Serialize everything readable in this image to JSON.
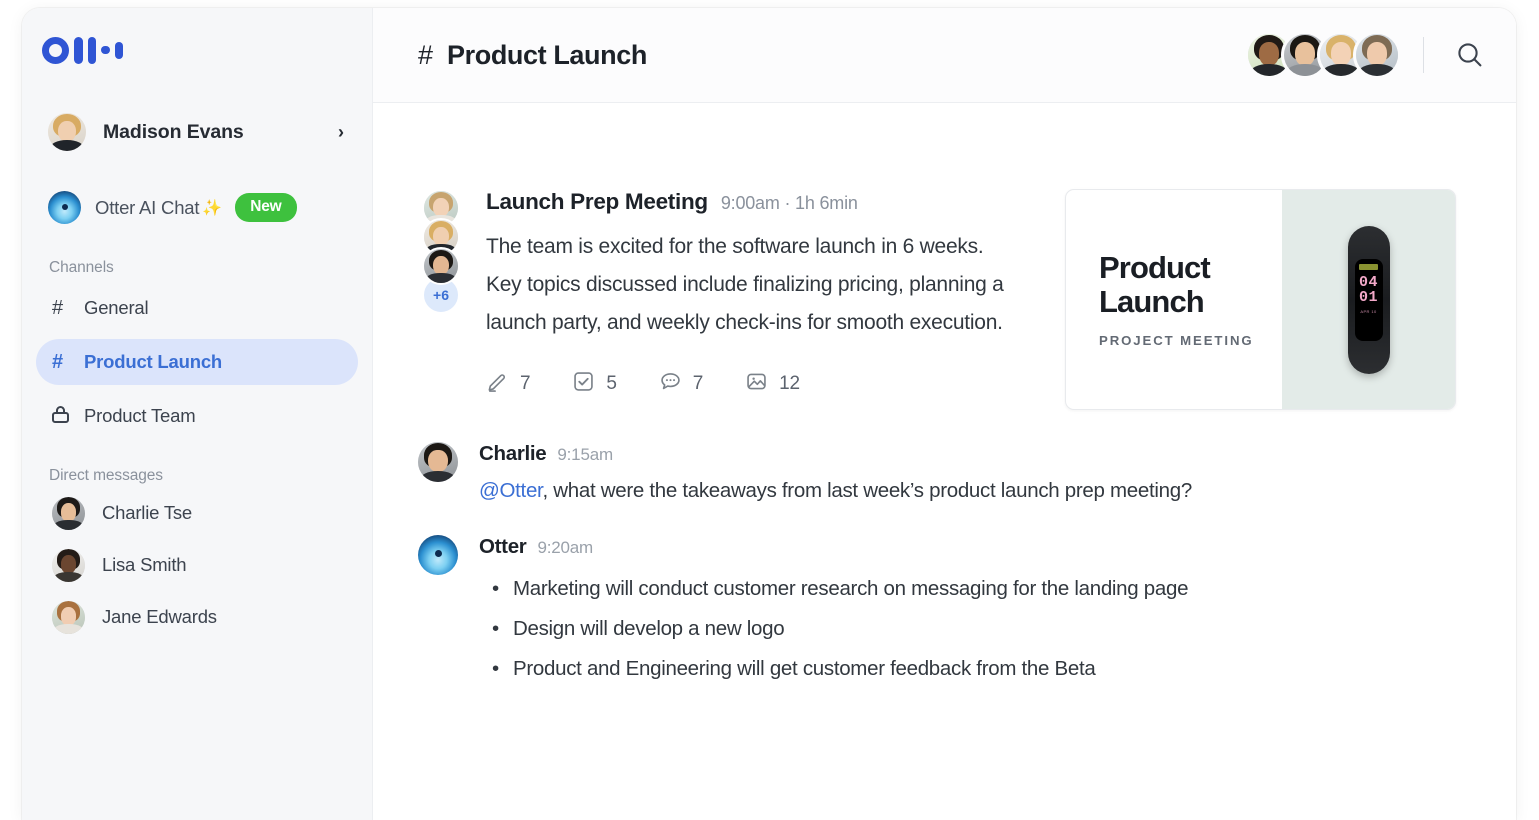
{
  "brand": {
    "logo_name": "otter-logo",
    "accent": "#2f55d4"
  },
  "sidebar": {
    "user": {
      "name": "Madison Evans",
      "chevron": "›"
    },
    "otter_chat": {
      "label": "Otter AI Chat",
      "sparkle": "✨",
      "badge": "New",
      "badge_color": "#3ec13e"
    },
    "channels_label": "Channels",
    "channels": [
      {
        "glyph": "#",
        "label": "General",
        "active": false,
        "icon": "hash-icon"
      },
      {
        "glyph": "#",
        "label": "Product Launch",
        "active": true,
        "icon": "hash-icon"
      },
      {
        "glyph": "lock",
        "label": "Product Team",
        "active": false,
        "icon": "lock-icon"
      }
    ],
    "dm_label": "Direct messages",
    "dms": [
      {
        "name": "Charlie Tse"
      },
      {
        "name": "Lisa Smith"
      },
      {
        "name": "Jane Edwards"
      }
    ]
  },
  "header": {
    "hash": "#",
    "title": "Product Launch",
    "member_count_shown": 4,
    "search_icon": "search-icon"
  },
  "meeting": {
    "title": "Launch Prep Meeting",
    "time": "9:00am",
    "separator": "·",
    "duration": "1h 6min",
    "meta": "9:00am · 1h 6min",
    "summary": "The team is excited for the software launch in 6 weeks. Key topics discussed include finalizing pricing, planning a launch party, and weekly check-ins for smooth execution.",
    "extra_participants": "+6",
    "stats": [
      {
        "icon": "highlight-pen-icon",
        "count": "7"
      },
      {
        "icon": "checkbox-icon",
        "count": "5"
      },
      {
        "icon": "comment-icon",
        "count": "7"
      },
      {
        "icon": "image-icon",
        "count": "12"
      }
    ],
    "thumbnail": {
      "title_line1": "Product",
      "title_line2": "Launch",
      "subtitle": "PROJECT MEETING",
      "device_time_top": "04",
      "device_time_bottom": "01",
      "device_date": "APR 10",
      "panel_color": "#e3ebe8"
    }
  },
  "messages": [
    {
      "sender": "Charlie",
      "time": "9:15am",
      "mention": "@Otter",
      "text_after_mention": ", what were the takeaways from last week’s product launch prep meeting?",
      "type": "text"
    },
    {
      "sender": "Otter",
      "time": "9:20am",
      "type": "bullets",
      "bullets": [
        "Marketing will conduct customer research on messaging for the landing page",
        "Design will develop a new logo",
        "Product and Engineering will get customer feedback from the Beta"
      ]
    }
  ]
}
